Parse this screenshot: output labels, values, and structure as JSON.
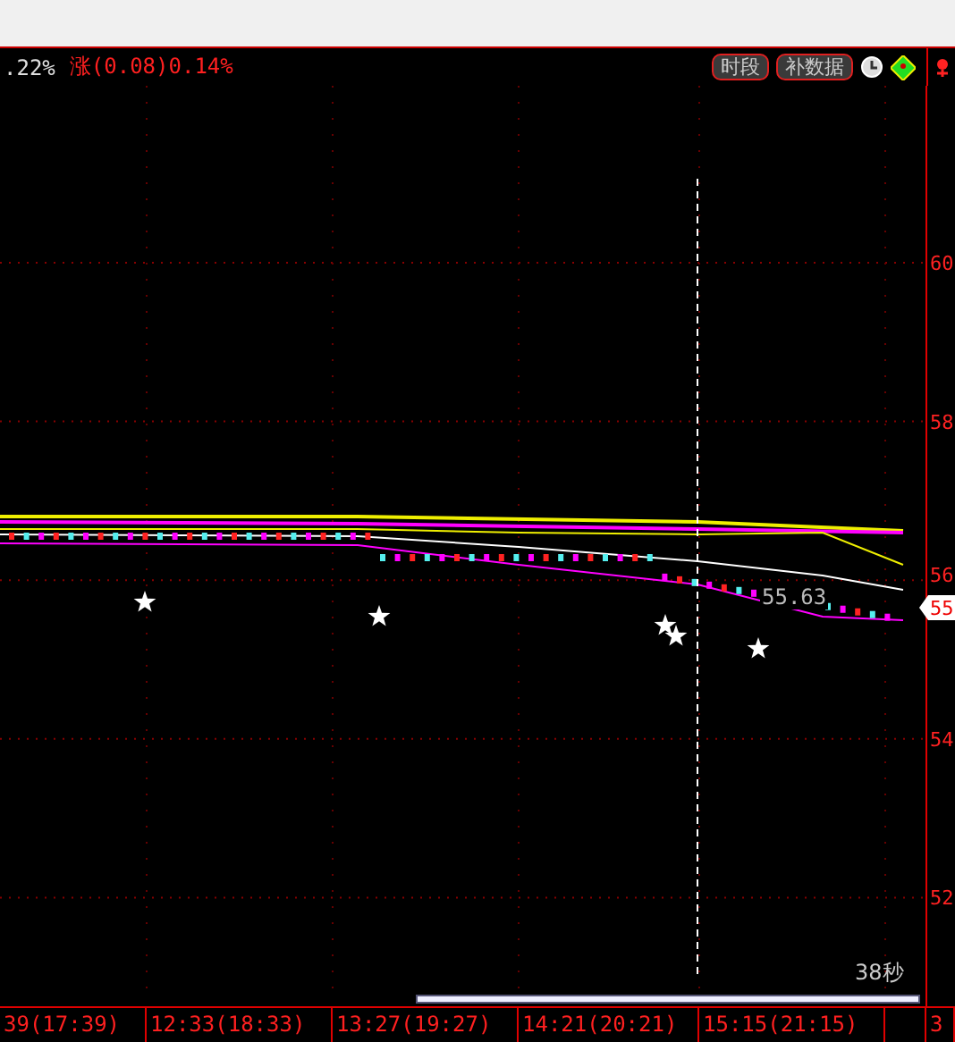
{
  "header": {
    "change_pct": ".22%",
    "change": "涨(0.08)0.14%",
    "buttons": [
      "时段",
      "补数据"
    ]
  },
  "price_axis": {
    "labels": [
      "60",
      "58",
      "56",
      "54",
      "52"
    ],
    "current_price": "55"
  },
  "chart": {
    "overlay_value": "55.63",
    "countdown": "38秒"
  },
  "time_axis": {
    "labels": [
      "39(17:39)",
      "12:33(18:33)",
      "13:27(19:27)",
      "14:21(20:21)",
      "15:15(21:15)",
      "3"
    ]
  }
}
